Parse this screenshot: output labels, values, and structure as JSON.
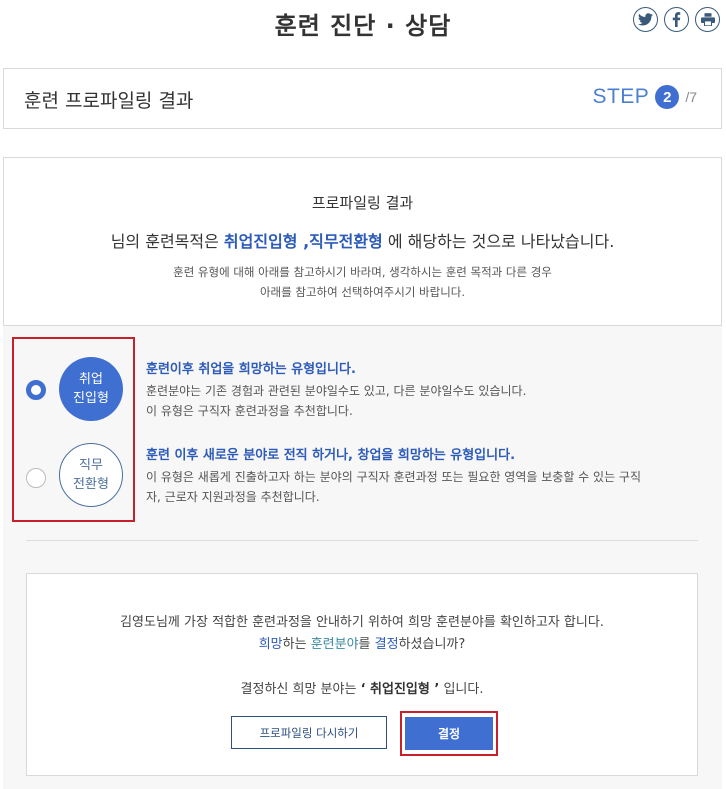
{
  "header": {
    "title": "훈련 진단 · 상담",
    "social": [
      {
        "icon": "twitter-icon"
      },
      {
        "icon": "facebook-icon"
      },
      {
        "icon": "print-icon"
      }
    ],
    "icon_color": "#3a5a7a"
  },
  "step": {
    "title": "훈련 프로파일링 결과",
    "label": "STEP",
    "current": "2",
    "total": "/7"
  },
  "result": {
    "heading": "프로파일링 결과",
    "main_prefix": "님의 훈련목적은 ",
    "main_highlight": "취업진입형 ,직무전환형",
    "main_suffix": " 에 해당하는 것으로 나타났습니다.",
    "desc_line1": "훈련 유형에 대해 아래를 참고하시기 바라며, 생각하시는 훈련 목적과 다른 경우",
    "desc_line2": "아래를 참고하여 선택하여주시기 바랍니다."
  },
  "types": [
    {
      "circle_line1": "취업",
      "circle_line2": "진입형",
      "selected": true,
      "title": "훈련이후 취업을 희망하는 유형입니다.",
      "desc_line1": "훈련분야는 기존 경험과 관련된 분야일수도 있고, 다른 분야일수도 있습니다.",
      "desc_line2": "이 유형은 구직자 훈련과정을 추천합니다."
    },
    {
      "circle_line1": "직무",
      "circle_line2": "전환형",
      "selected": false,
      "title": "훈련 이후 새로운 분야로 전직 하거나, 창업을 희망하는 유형입니다.",
      "desc_line1": "이 유형은 새롭게 진출하고자 하는 분야의 구직자 훈련과정 또는 필요한 영역을 보충할 수 있는 구직",
      "desc_line2": "자, 근로자 지원과정을 추천합니다."
    }
  ],
  "confirm": {
    "line1": "김영도님께 가장 적합한 훈련과정을 안내하기 위하여 희망 훈련분야를 확인하고자 합니다.",
    "line2_a": "희망",
    "line2_b": "하는 ",
    "line2_c": "훈련분야",
    "line2_d": "를 ",
    "line2_e": "결정",
    "line2_f": "하셨습니까?",
    "line3_prefix": "결정하신 희망 분야는 ",
    "line3_value": "‘ 취업진입형 ’",
    "line3_suffix": " 입니다.",
    "reset_label": "프로파일링 다시하기",
    "confirm_label": "결정"
  },
  "colors": {
    "accent": "#3f6fd0",
    "highlight_text": "#2d5bb8",
    "annotation_red": "#c8202a"
  }
}
